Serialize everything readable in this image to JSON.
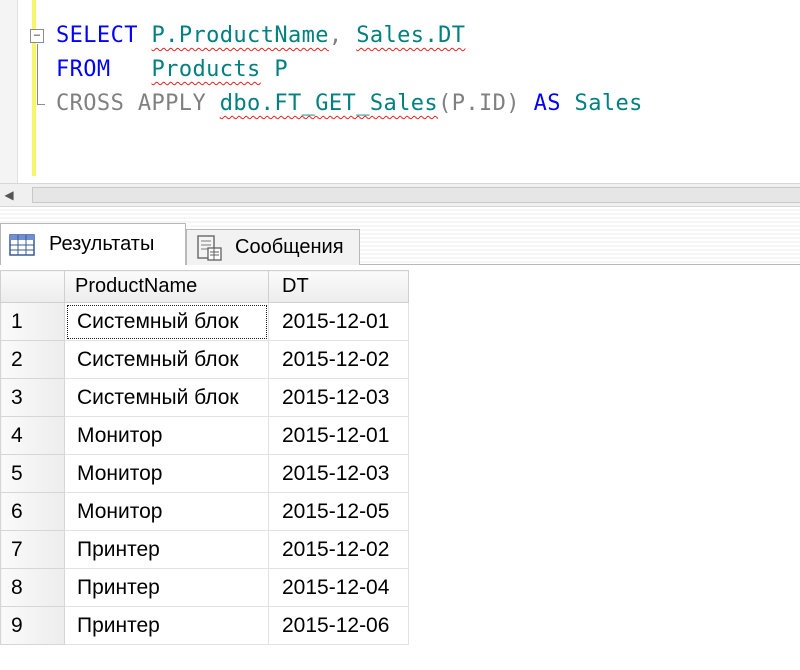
{
  "editor": {
    "lines": [
      [
        {
          "text": "SELECT",
          "cls": "kw"
        },
        {
          "text": " ",
          "cls": "txt"
        },
        {
          "text": "P.ProductName",
          "cls": "id squig"
        },
        {
          "text": ", ",
          "cls": "gray"
        },
        {
          "text": "Sales.DT",
          "cls": "id squig"
        }
      ],
      [
        {
          "text": "FROM",
          "cls": "kw"
        },
        {
          "text": "   ",
          "cls": "txt"
        },
        {
          "text": "Products",
          "cls": "id squig"
        },
        {
          "text": " P",
          "cls": "id"
        }
      ],
      [
        {
          "text": "CROSS APPLY ",
          "cls": "gray"
        },
        {
          "text": "dbo.FT_GET_Sales",
          "cls": "id squig"
        },
        {
          "text": "(P.ID) ",
          "cls": "gray"
        },
        {
          "text": "AS",
          "cls": "kw"
        },
        {
          "text": " Sales",
          "cls": "id"
        }
      ]
    ],
    "collapse_glyph": "−"
  },
  "scrollbar": {
    "left_arrow": "◀"
  },
  "tabs": {
    "results_label": "Результаты",
    "messages_label": "Сообщения"
  },
  "grid": {
    "columns": [
      "ProductName",
      "DT"
    ],
    "rows": [
      {
        "num": "1",
        "name": "Системный блок",
        "dt": "2015-12-01"
      },
      {
        "num": "2",
        "name": "Системный блок",
        "dt": "2015-12-02"
      },
      {
        "num": "3",
        "name": "Системный блок",
        "dt": "2015-12-03"
      },
      {
        "num": "4",
        "name": "Монитор",
        "dt": "2015-12-01"
      },
      {
        "num": "5",
        "name": "Монитор",
        "dt": "2015-12-03"
      },
      {
        "num": "6",
        "name": "Монитор",
        "dt": "2015-12-05"
      },
      {
        "num": "7",
        "name": "Принтер",
        "dt": "2015-12-02"
      },
      {
        "num": "8",
        "name": "Принтер",
        "dt": "2015-12-04"
      },
      {
        "num": "9",
        "name": "Принтер",
        "dt": "2015-12-06"
      }
    ]
  }
}
